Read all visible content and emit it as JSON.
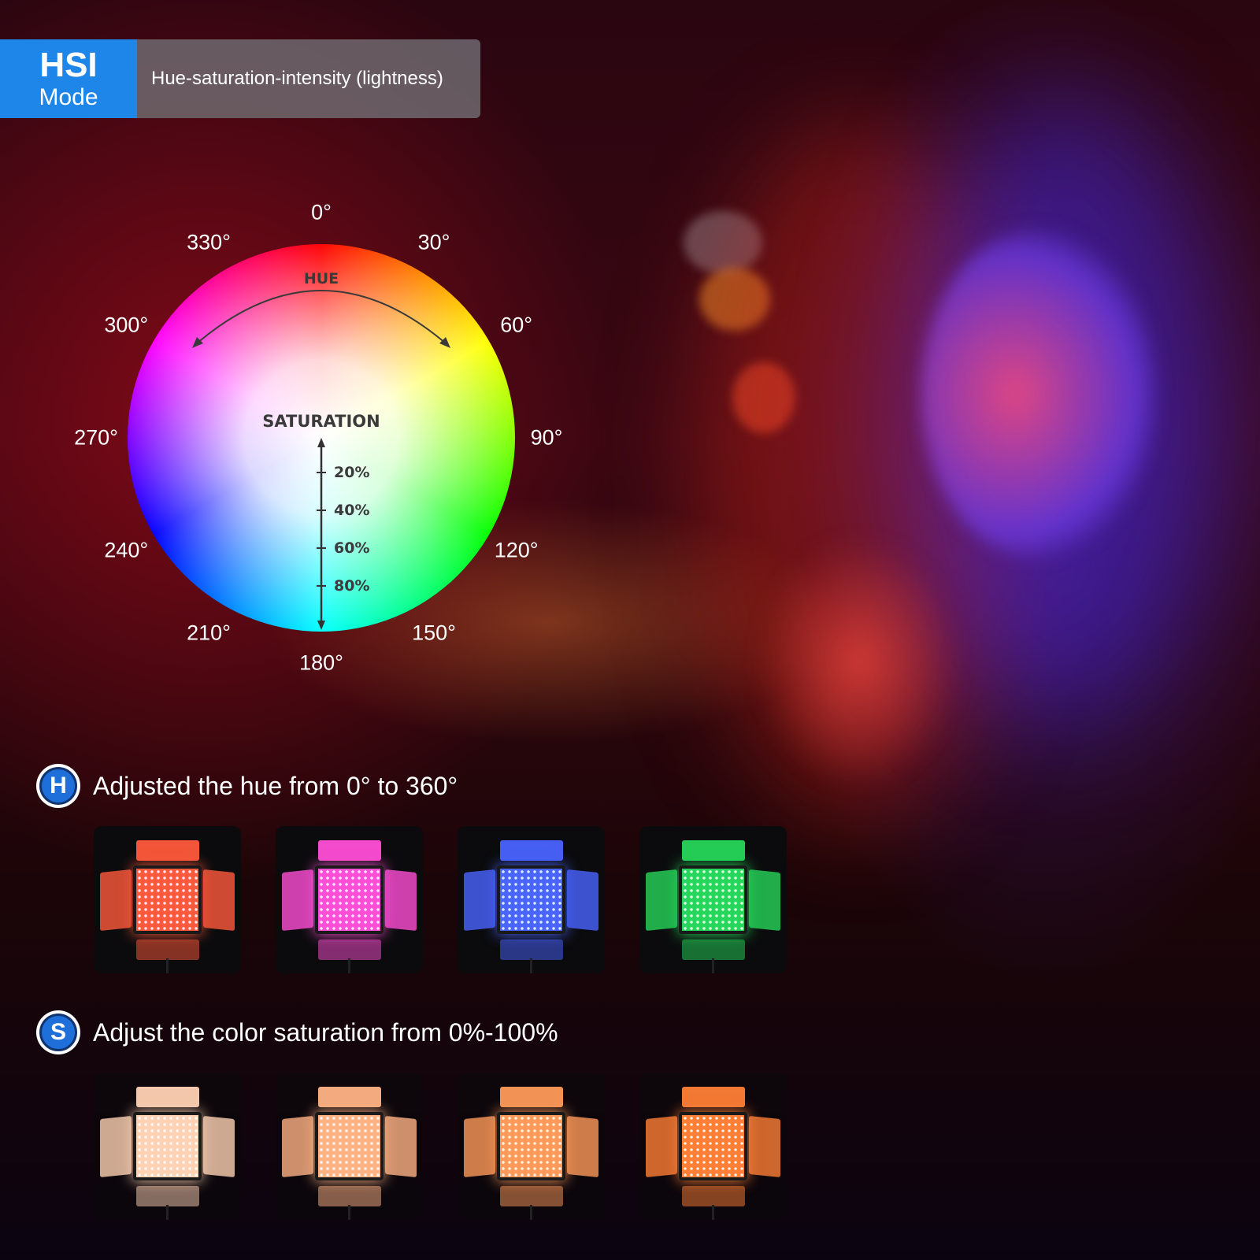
{
  "header": {
    "mode_big": "HSI",
    "mode_small": "Mode",
    "description": "Hue-saturation-intensity (lightness)"
  },
  "wheel": {
    "hue_label": "HUE",
    "saturation_label": "SATURATION",
    "saturation_ticks": [
      "20%",
      "40%",
      "60%",
      "80%"
    ],
    "angles": [
      "0°",
      "30°",
      "60°",
      "90°",
      "120°",
      "150°",
      "180°",
      "210°",
      "240°",
      "270°",
      "300°",
      "330°"
    ]
  },
  "hue_section": {
    "badge": "H",
    "text": "Adjusted the hue from 0° to 360°",
    "colors": [
      "#ff5a3c",
      "#ff4fd6",
      "#4a64ff",
      "#27d65a"
    ]
  },
  "saturation_section": {
    "badge": "S",
    "text": "Adjust the color saturation from 0%-100%",
    "colors": [
      "#ffd2b4",
      "#ffb385",
      "#ff9a5a",
      "#ff7f36"
    ]
  },
  "colors": {
    "badge_blue": "#1e86e8",
    "description_gray": "#6e696e"
  }
}
